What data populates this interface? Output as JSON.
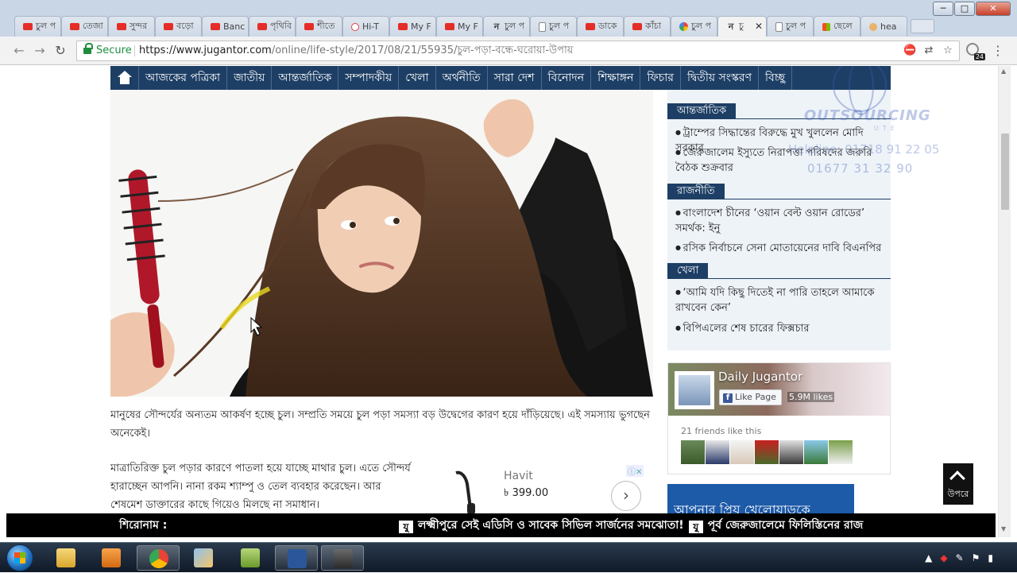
{
  "browser": {
    "tabs": [
      {
        "label": "চুল প",
        "icon": "yt"
      },
      {
        "label": "তেজা",
        "icon": "yt"
      },
      {
        "label": "সুন্দর",
        "icon": "yt"
      },
      {
        "label": "বড়ো",
        "icon": "yt"
      },
      {
        "label": "Banc",
        "icon": "yt"
      },
      {
        "label": "পৃথিবি",
        "icon": "yt"
      },
      {
        "label": "শীতে",
        "icon": "yt"
      },
      {
        "label": "Hi-T",
        "icon": "hi"
      },
      {
        "label": "My F",
        "icon": "yt"
      },
      {
        "label": "My F",
        "icon": "yt"
      },
      {
        "label": "চুল প",
        "icon": "tr"
      },
      {
        "label": "চুল প",
        "icon": "doc"
      },
      {
        "label": "ডাকে",
        "icon": "yt"
      },
      {
        "label": "কাঁচা",
        "icon": "yt"
      },
      {
        "label": "চুল প",
        "icon": "g"
      },
      {
        "label": "চু",
        "icon": "tr",
        "active": true
      },
      {
        "label": "চুল প",
        "icon": "doc"
      },
      {
        "label": "ছেলে",
        "icon": "ms"
      },
      {
        "label": "hea",
        "icon": "fd"
      }
    ],
    "window_buttons": {
      "minimize": "─",
      "maximize": "□",
      "close": "✕"
    },
    "nav": {
      "back": "←",
      "forward": "→",
      "reload": "↻"
    },
    "secure_label": "Secure",
    "url_host": "https://www.jugantor.com",
    "url_path": "/online/life-style/2017/08/21/55935/চুল-পড়া-বন্ধে-ঘরোয়া-উপায়",
    "extension_badge": "24",
    "menu_icon": "⋮"
  },
  "site": {
    "nav_items": [
      "আজকের পত্রিকা",
      "জাতীয়",
      "আন্তর্জাতিক",
      "সম্পাদকীয়",
      "খেলা",
      "অর্থনীতি",
      "সারা দেশ",
      "বিনোদন",
      "শিক্ষাঙ্গন",
      "ফিচার",
      "দ্বিতীয় সংস্করণ",
      "বিচ্ছু"
    ],
    "para1": "মানুষের সৌন্দর্যের অন্যতম আকর্ষণ হচ্ছে চুল। সম্প্রতি সময়ে চুল পড়া সমস্যা বড় উদ্বেগের কারণ হয়ে দাঁড়িয়েছে। এই সমস্যায় ভুগছেন অনেকেই।",
    "para2": "মাত্রাতিরিক্ত চুল পড়ার কারণে পাতলা হয়ে যাচ্ছে মাথার চুল। এতে সৌন্দর্য হারাচ্ছেন আপনি। নানা রকম শ্যাম্পু ও তেল ব্যবহার করেছেন। আর শেষমেশ ডাক্তারের কাছে গিয়েও মিলছে না সমাধান।",
    "ad": {
      "title": "Havit",
      "price": "৳ 399.00",
      "arrow": "›",
      "info": "ⓘ✕"
    },
    "sidebar": {
      "sections": [
        {
          "head": "আন্তর্জাতিক",
          "items": [
            "ট্রাম্পের সিদ্ধান্তের বিরুদ্ধে মুখ খুললেন মোদি সরকার",
            "জেরুজালেম ইস্যুতে নিরাপত্তা পরিষদের জরুরি বৈঠক শুক্রবার"
          ]
        },
        {
          "head": "রাজনীতি",
          "items": [
            "বাংলাদেশ চীনের ‘ওয়ান বেল্ট ওয়ান রোডের’ সমর্থক: ইনু",
            "রসিক নির্বাচনে সেনা মোতায়েনের দাবি বিএনপির"
          ]
        },
        {
          "head": "খেলা",
          "items": [
            "‘আমি যদি কিছু দিতেই না পারি তাহলে আমাকে রাখবেন কেন’",
            "বিপিএলের শেষ চারের ফিক্সচার"
          ]
        }
      ]
    },
    "watermark": {
      "brand": "OUTSOURCING",
      "sub": "UTE",
      "helpline": "Helpline: 01718 91 22 05",
      "phone2": "01677  31  32  90"
    },
    "facebook": {
      "page_name": "Daily Jugantor",
      "like_label": "Like Page",
      "like_icon": "f",
      "likes": "5.9M likes",
      "friends": "21 friends like this"
    },
    "blue_banner": "আপনার প্রিয় খেলোয়াড়কে",
    "to_top_label": "উপরে",
    "ticker": {
      "label": "শিরোনাম :",
      "mark": "যু",
      "headline1": "লক্ষ্মীপুরে সেই এডিসি ও সাবেক সিভিল সার্জনের সমঝোতা!",
      "headline2": "পূর্ব জেরুজালেমে ফিলিস্তিনের রাজ"
    }
  },
  "colors": {
    "nav_bg": "#1e3f65",
    "sidebar_bg": "#eef3f8",
    "secure": "#1e8e3e"
  }
}
